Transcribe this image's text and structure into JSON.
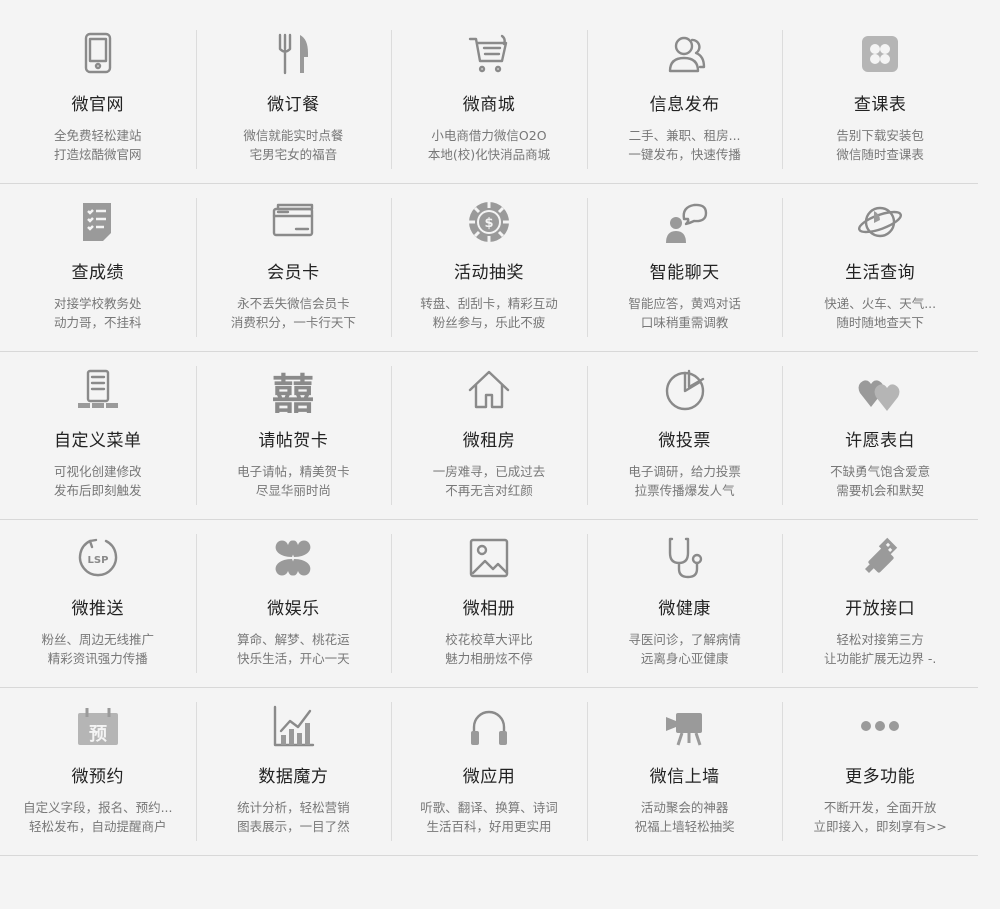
{
  "rows": [
    [
      {
        "title": "微官网",
        "desc": [
          "全免费轻松建站",
          "打造炫酷微官网"
        ],
        "icon": "tablet-icon"
      },
      {
        "title": "微订餐",
        "desc": [
          "微信就能实时点餐",
          "宅男宅女的福音"
        ],
        "icon": "fork-knife-icon"
      },
      {
        "title": "微商城",
        "desc": [
          "小电商借力微信O2O",
          "本地(校)化快消品商城"
        ],
        "icon": "shopping-cart-icon"
      },
      {
        "title": "信息发布",
        "desc": [
          "二手、兼职、租房...",
          "一键发布，快速传播"
        ],
        "icon": "users-icon"
      },
      {
        "title": "查课表",
        "desc": [
          "告别下载安装包",
          "微信随时查课表"
        ],
        "icon": "clover-app-icon"
      }
    ],
    [
      {
        "title": "查成绩",
        "desc": [
          "对接学校教务处",
          "动力哥，不挂科"
        ],
        "icon": "checklist-icon"
      },
      {
        "title": "会员卡",
        "desc": [
          "永不丢失微信会员卡",
          "消费积分，一卡行天下"
        ],
        "icon": "card-icon"
      },
      {
        "title": "活动抽奖",
        "desc": [
          "转盘、刮刮卡，精彩互动",
          "粉丝参与，乐此不疲"
        ],
        "icon": "poker-chip-icon"
      },
      {
        "title": "智能聊天",
        "desc": [
          "智能应答，黄鸡对话",
          "口味稍重需调教"
        ],
        "icon": "chat-person-icon"
      },
      {
        "title": "生活查询",
        "desc": [
          "快递、火车、天气...",
          "随时随地查天下"
        ],
        "icon": "planet-icon"
      }
    ],
    [
      {
        "title": "自定义菜单",
        "desc": [
          "可视化创建修改",
          "发布后即刻触发"
        ],
        "icon": "menu-phone-icon"
      },
      {
        "title": "请帖贺卡",
        "desc": [
          "电子请帖，精美贺卡",
          "尽显华丽时尚"
        ],
        "icon": "double-happiness-icon"
      },
      {
        "title": "微租房",
        "desc": [
          "一房难寻，已成过去",
          "不再无言对红颜"
        ],
        "icon": "house-icon"
      },
      {
        "title": "微投票",
        "desc": [
          "电子调研，给力投票",
          "拉票传播爆发人气"
        ],
        "icon": "pie-chart-icon"
      },
      {
        "title": "许愿表白",
        "desc": [
          "不缺勇气饱含爱意",
          "需要机会和默契"
        ],
        "icon": "hearts-icon"
      }
    ],
    [
      {
        "title": "微推送",
        "desc": [
          "粉丝、周边无线推广",
          "精彩资讯强力传播"
        ],
        "icon": "lsp-refresh-icon"
      },
      {
        "title": "微娱乐",
        "desc": [
          "算命、解梦、桃花运",
          "快乐生活，开心一天"
        ],
        "icon": "clover-icon"
      },
      {
        "title": "微相册",
        "desc": [
          "校花校草大评比",
          "魅力相册炫不停"
        ],
        "icon": "picture-icon"
      },
      {
        "title": "微健康",
        "desc": [
          "寻医问诊，了解病情",
          "远离身心亚健康"
        ],
        "icon": "stethoscope-icon"
      },
      {
        "title": "开放接口",
        "desc": [
          "轻松对接第三方",
          "让功能扩展无边界 -."
        ],
        "icon": "usb-plug-icon"
      }
    ],
    [
      {
        "title": "微预约",
        "desc": [
          "自定义字段，报名、预约...",
          "轻松发布，自动提醒商户"
        ],
        "icon": "calendar-icon",
        "icon_text": "预"
      },
      {
        "title": "数据魔方",
        "desc": [
          "统计分析，轻松营销",
          "图表展示，一目了然"
        ],
        "icon": "bar-chart-icon"
      },
      {
        "title": "微应用",
        "desc": [
          "听歌、翻译、换算、诗词",
          "生活百科，好用更实用"
        ],
        "icon": "headphones-icon"
      },
      {
        "title": "微信上墙",
        "desc": [
          "活动聚会的神器",
          "祝福上墙轻松抽奖"
        ],
        "icon": "projector-icon"
      },
      {
        "title": "更多功能",
        "desc": [
          "不断开发，全面开放",
          "立即接入，即刻享有>>"
        ],
        "icon": "more-dots-icon"
      }
    ]
  ],
  "icon_color": "#8a8a8a",
  "icon_text_lsp": "LSP"
}
